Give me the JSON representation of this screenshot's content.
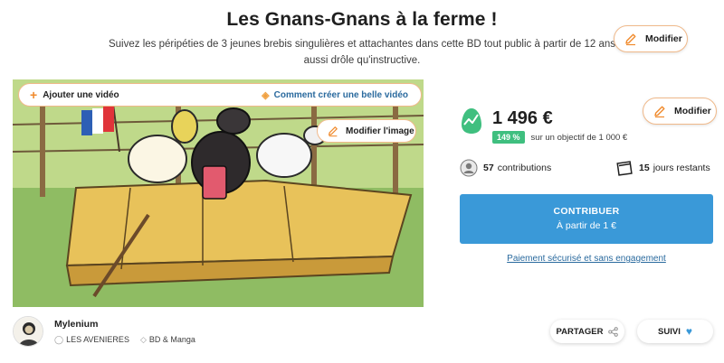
{
  "header": {
    "title": "Les Gnans-Gnans à la ferme !",
    "subtitle": "Suivez les péripéties de 3 jeunes brebis singulières et attachantes dans cette BD tout public à partir de 12 ans aussi drôle qu'instructive."
  },
  "edit_buttons": {
    "top_label": "Modifier",
    "right_label": "Modifier"
  },
  "hero": {
    "add_video_label": "Ajouter une vidéo",
    "video_help_label": "Comment créer une belle vidéo",
    "edit_image_label": "Modifier l'image"
  },
  "funding": {
    "amount": "1 496 €",
    "percent": "149 %",
    "goal_text": "sur un objectif de 1 000 €",
    "progress_fraction": 1.49
  },
  "stats": {
    "contributions_count": "57",
    "contributions_label": "contributions",
    "days_count": "15",
    "days_label": "jours restants"
  },
  "cta": {
    "label": "CONTRIBUER",
    "sub_label": "À partir de 1 €",
    "secure_text": "Paiement sécurisé et sans engagement"
  },
  "author": {
    "name": "Mylenium",
    "location": "LES AVENIERES",
    "category": "BD & Manga"
  },
  "actions": {
    "share_label": "PARTAGER",
    "follow_label": "SUIVI"
  },
  "colors": {
    "accent_blue": "#3a99d8",
    "accent_orange": "#f08a2c",
    "success_green": "#3fbf7f"
  },
  "icons": {
    "edit": "pencil-icon",
    "add": "plus-icon",
    "help": "lightbulb-icon",
    "goal": "egg-chart-icon",
    "contributors": "contributors-icon",
    "calendar": "calendar-icon",
    "location": "location-pin-icon",
    "category": "tag-icon",
    "share": "share-icon",
    "follow": "heart-icon"
  }
}
